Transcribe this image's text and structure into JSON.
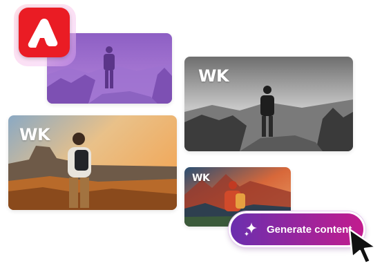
{
  "cards": {
    "grayscale_label": "WK",
    "sunset_label": "WK",
    "illustration_label": "WK"
  },
  "action_button": {
    "label": "Generate content",
    "gradient_start": "#6b2fae",
    "gradient_end": "#c21c8e"
  },
  "colors": {
    "logo": "#ea1c24",
    "purple_tint": "#9a63c9"
  },
  "icons": {
    "logo": "adobe-express-icon",
    "sparkle": "sparkles-icon",
    "cursor": "mouse-pointer-icon"
  }
}
